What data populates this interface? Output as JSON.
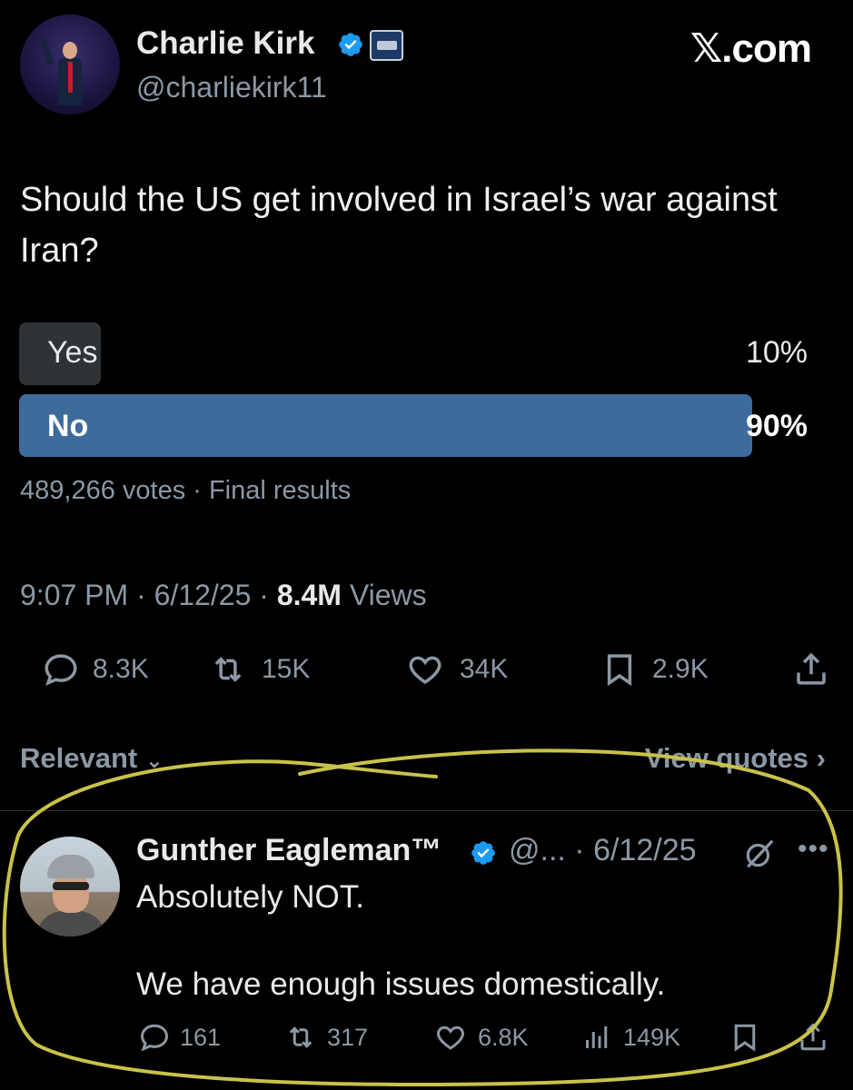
{
  "author": {
    "name": "Charlie Kirk",
    "handle": "@charliekirk11",
    "verified": true,
    "org_badge": "organization-affiliation-badge"
  },
  "site_watermark": "𝕏.com",
  "tweet": {
    "text": "Should the US get involved in Israel’s war against Iran?",
    "poll": {
      "options": [
        {
          "label": "Yes",
          "percent_text": "10%",
          "percent": 10
        },
        {
          "label": "No",
          "percent_text": "90%",
          "percent": 90
        }
      ],
      "meta": "489,266 votes · Final results"
    },
    "time": "9:07 PM · 6/12/25 · ",
    "views_count": "8.4M",
    "views_label": " Views",
    "actions": {
      "replies": "8.3K",
      "reposts": "15K",
      "likes": "34K",
      "bookmarks": "2.9K"
    }
  },
  "replies_header": {
    "sort_label": "Relevant",
    "quotes_label": "View quotes"
  },
  "reply": {
    "name": "Gunther Eagleman™",
    "handle_date": "@... · 6/12/25",
    "line1": "Absolutely NOT.",
    "line2": "We have enough issues domestically.",
    "actions": {
      "replies": "161",
      "reposts": "317",
      "likes": "6.8K",
      "views": "149K"
    }
  },
  "colors": {
    "background": "#000000",
    "poll_winner": "#3e6b9c",
    "poll_other": "#2f3336",
    "muted_text": "#8b98a5",
    "verified_blue": "#1d9bf0",
    "highlight": "#c9c24a"
  }
}
